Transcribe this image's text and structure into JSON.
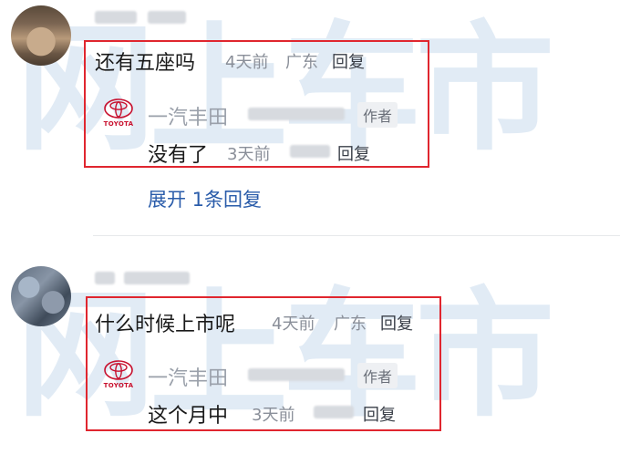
{
  "watermark": {
    "text": "网上车市"
  },
  "thread1": {
    "comment": {
      "text": "还有五座吗",
      "time": "4天前",
      "location": "广东",
      "reply_label": "回复"
    },
    "reply": {
      "author": "一汽丰田",
      "author_tag": "作者",
      "logo_text": "TOYOTA",
      "text": "没有了",
      "time": "3天前",
      "reply_label": "回复"
    },
    "expand_label": "展开 1条回复"
  },
  "thread2": {
    "comment": {
      "text": "什么时候上市呢",
      "time": "4天前",
      "location": "广东",
      "reply_label": "回复"
    },
    "reply": {
      "author": "一汽丰田",
      "author_tag": "作者",
      "logo_text": "TOYOTA",
      "text": "这个月中",
      "time": "3天前",
      "reply_label": "回复"
    }
  },
  "colors": {
    "highlight": "#e0262f",
    "link": "#2a5caa",
    "meta": "#8a8f99",
    "watermark": "#78a5d2",
    "brand": "#c8102e"
  }
}
